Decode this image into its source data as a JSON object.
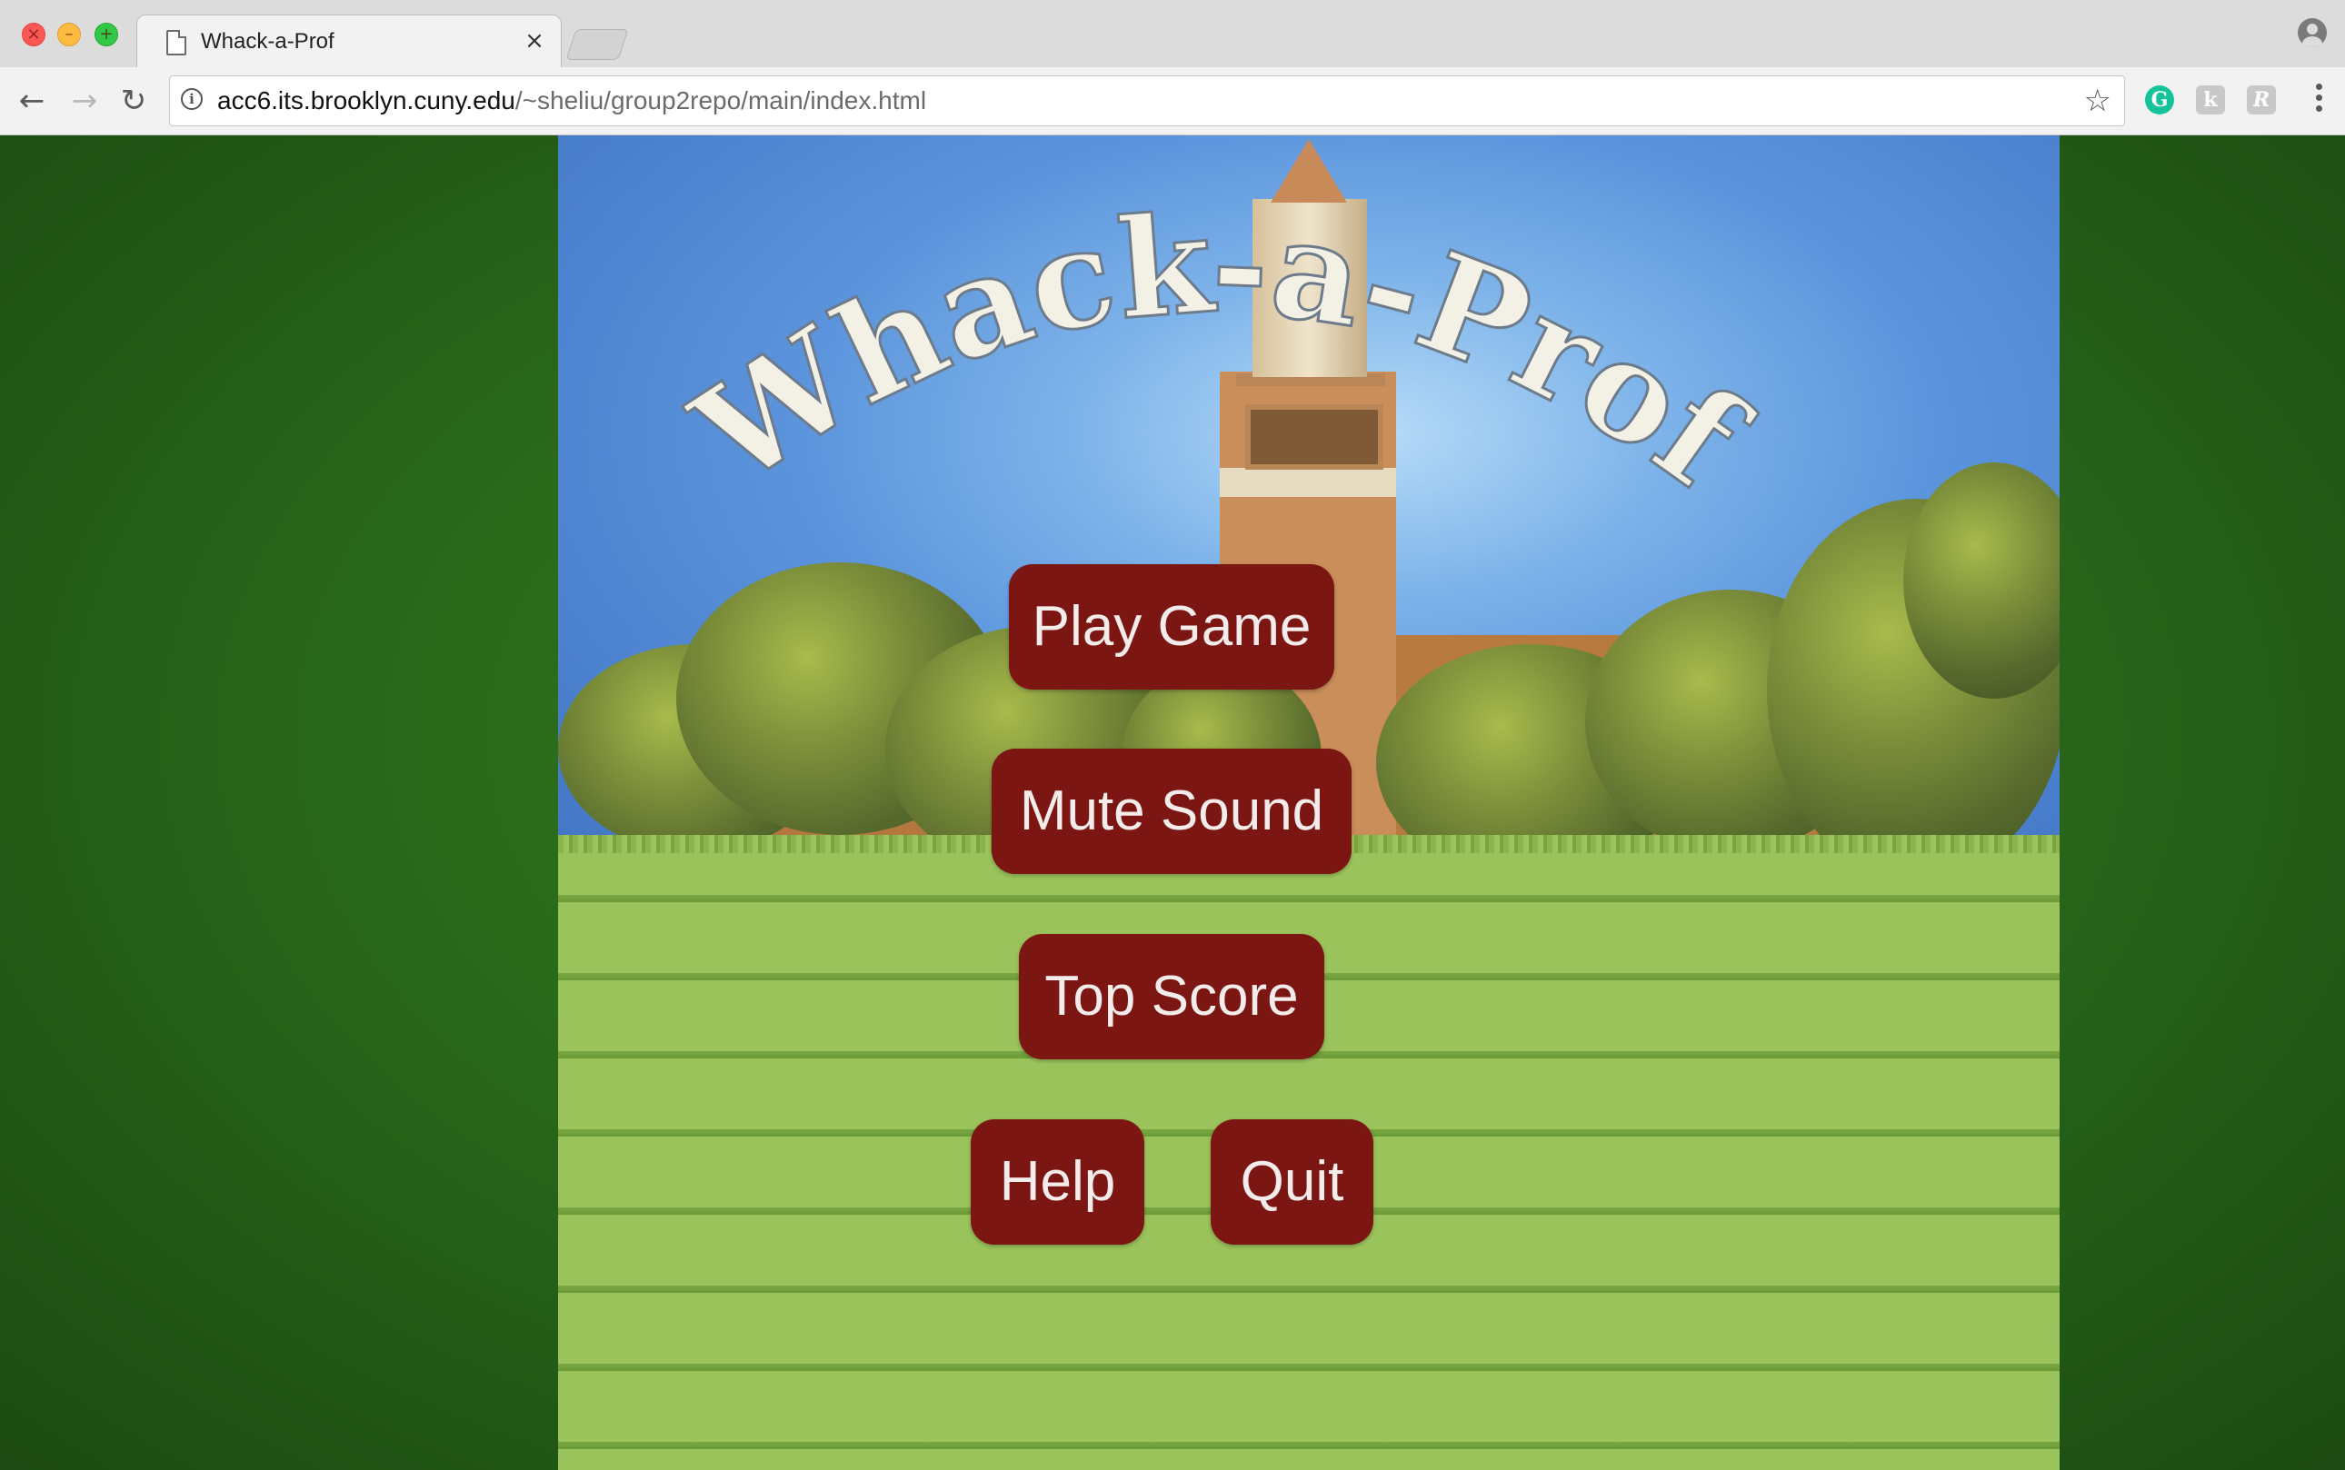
{
  "browser": {
    "tab_title": "Whack-a-Prof",
    "url_host": "acc6.its.brooklyn.cuny.edu",
    "url_path": "/~sheliu/group2repo/main/index.html",
    "extensions": [
      "G",
      "k",
      "R"
    ],
    "icons": {
      "close": "close-icon",
      "minimize": "minimize-icon",
      "maximize": "maximize-icon",
      "back": "back-arrow-icon",
      "forward": "forward-arrow-icon",
      "reload": "reload-icon",
      "info": "info-icon",
      "star": "star-icon",
      "profile": "profile-icon",
      "menu": "menu-dots-icon"
    }
  },
  "game": {
    "title": "Whack-a-Prof",
    "buttons": {
      "play": "Play Game",
      "mute": "Mute Sound",
      "top_score": "Top Score",
      "help": "Help",
      "quit": "Quit"
    }
  },
  "colors": {
    "button_bg": "#7c1612",
    "button_text": "#f4ecea",
    "side_background": "#2a6a1b",
    "sky": "#5b94dc",
    "grass": "#9bc35b"
  }
}
